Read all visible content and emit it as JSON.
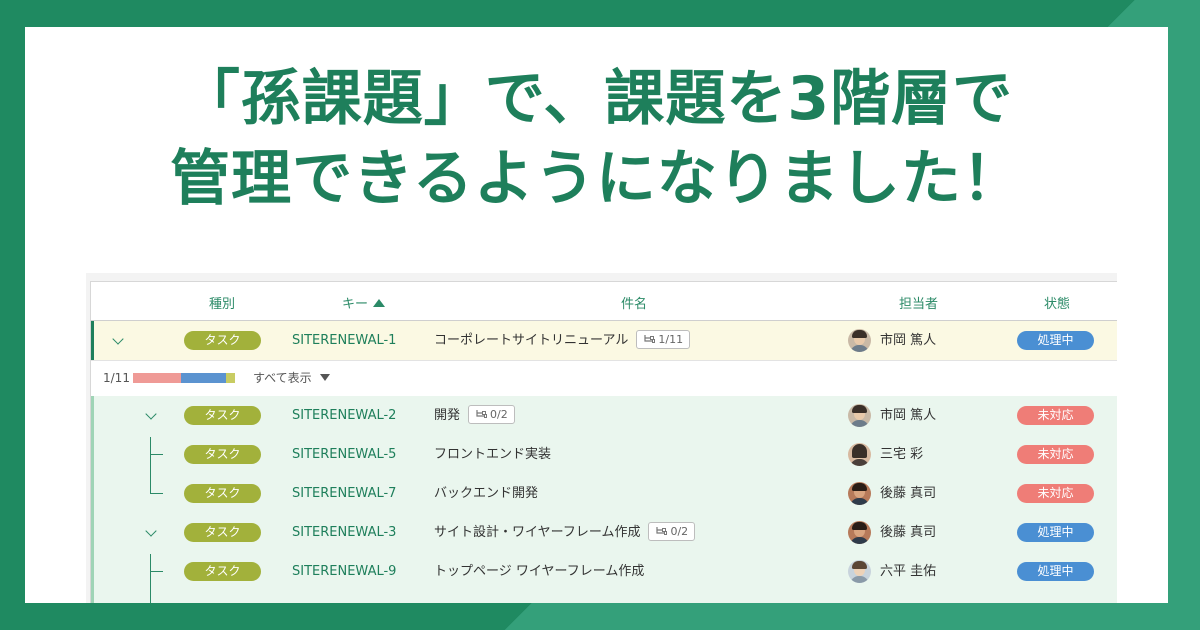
{
  "headline": {
    "line1": "「孫課題」で、課題を3階層で",
    "line2": "管理できるようになりました！"
  },
  "table": {
    "columns": {
      "type": "種別",
      "key": "キー",
      "subject": "件名",
      "assignee": "担当者",
      "status": "状態"
    },
    "progress": {
      "count": "1/11",
      "show_all": "すべて表示"
    },
    "rows": [
      {
        "type": "タスク",
        "key": "SITERENEWAL-1",
        "subject": "コーポレートサイトリニューアル",
        "subcount": "1/11",
        "assignee": "市岡 篤人",
        "status": "処理中"
      },
      {
        "type": "タスク",
        "key": "SITERENEWAL-2",
        "subject": "開発",
        "subcount": "0/2",
        "assignee": "市岡 篤人",
        "status": "未対応"
      },
      {
        "type": "タスク",
        "key": "SITERENEWAL-5",
        "subject": "フロントエンド実装",
        "assignee": "三宅 彩",
        "status": "未対応"
      },
      {
        "type": "タスク",
        "key": "SITERENEWAL-7",
        "subject": "バックエンド開発",
        "assignee": "後藤 真司",
        "status": "未対応"
      },
      {
        "type": "タスク",
        "key": "SITERENEWAL-3",
        "subject": "サイト設計・ワイヤーフレーム作成",
        "subcount": "0/2",
        "assignee": "後藤 真司",
        "status": "処理中"
      },
      {
        "type": "タスク",
        "key": "SITERENEWAL-9",
        "subject": "トップページ ワイヤーフレーム作成",
        "assignee": "六平 圭佑",
        "status": "処理中"
      }
    ]
  },
  "colors": {
    "brand_green": "#1e7f5b",
    "type_badge": "#a2b13b",
    "status_in_progress": "#4a8fd3",
    "status_open": "#ef7d77",
    "progress_segments": [
      "#ef9a96",
      "#5b93d0",
      "#c8cc62"
    ]
  }
}
